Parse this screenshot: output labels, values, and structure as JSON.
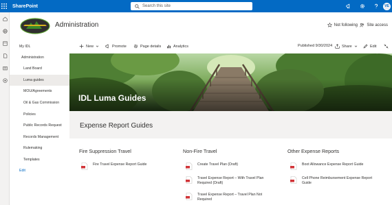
{
  "suite": {
    "brand": "SharePoint",
    "search_placeholder": "Search this site",
    "avatar_initials": "VE",
    "color": "#036ac4"
  },
  "site": {
    "title": "Administration",
    "follow_label": "Not following",
    "access_label": "Site access"
  },
  "nav": {
    "items": [
      {
        "label": "My IDL"
      },
      {
        "label": "Administration"
      },
      {
        "label": "Land Board"
      },
      {
        "label": "Luma guides",
        "selected": true
      },
      {
        "label": "MOU/Agreements"
      },
      {
        "label": "Oil & Gas Commission"
      },
      {
        "label": "Policies"
      },
      {
        "label": "Public Records Request"
      },
      {
        "label": "Records Management"
      },
      {
        "label": "Rulemaking"
      },
      {
        "label": "Templates"
      }
    ],
    "edit_label": "Edit"
  },
  "command": {
    "new_label": "New",
    "promote_label": "Promote",
    "details_label": "Page details",
    "analytics_label": "Analytics",
    "published_label": "Published 9/30/2024",
    "share_label": "Share",
    "edit_label": "Edit"
  },
  "hero": {
    "title": "IDL Luma Guides"
  },
  "band": {
    "title": "Expense Report Guides"
  },
  "sections": [
    {
      "heading": "Fire Suppression Travel",
      "docs": [
        {
          "line1": "Fire Travel Expense Report Guide",
          "line2": ""
        }
      ]
    },
    {
      "heading": "Non-Fire Travel",
      "docs": [
        {
          "line1": "Create Travel Plan (Draft)",
          "line2": ""
        },
        {
          "line1": "Travel Expense Report – With Travel Plan",
          "line2": "Required (Draft)"
        },
        {
          "line1": "Travel Expense Report – Travel Plan Not",
          "line2": "Required"
        }
      ]
    },
    {
      "heading": "Other Expense Reports",
      "docs": [
        {
          "line1": "Boot Allowance Expense Report Guide",
          "line2": ""
        },
        {
          "line1": "Cell Phone Reimbursement Expense Report",
          "line2": "Guide"
        }
      ]
    }
  ]
}
